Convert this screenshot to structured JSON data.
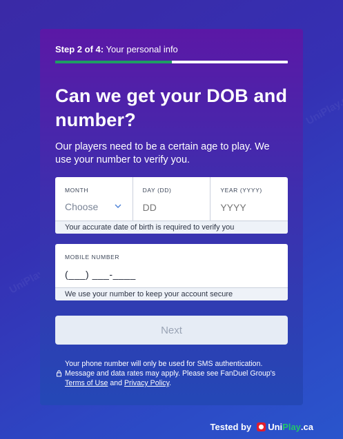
{
  "watermark": "UniPlay.ca",
  "step": {
    "prefix": "Step 2 of 4:",
    "label": "Your personal info",
    "progress": 0.5,
    "progress_color": "#1f9e63"
  },
  "heading": "Can we get your DOB and number?",
  "subtitle": "Our players need to be a certain age to play. We use your number to verify you.",
  "dob": {
    "month": {
      "label": "MONTH",
      "value": "Choose",
      "icon": "chevron-down-icon"
    },
    "day": {
      "label": "DAY (DD)",
      "placeholder": "DD"
    },
    "year": {
      "label": "YEAR (YYYY)",
      "placeholder": "YYYY"
    },
    "helper": "Your accurate date of birth is required to verify you"
  },
  "phone": {
    "label": "MOBILE NUMBER",
    "placeholder": "(___) ___-____",
    "helper": "We use your number to keep your account secure"
  },
  "next_label": "Next",
  "disclaimer": {
    "icon": "lock-icon",
    "text_before": "Your phone number will only be used for SMS authentication. Message and data rates may apply. Please see FanDuel Group's ",
    "terms": "Terms of Use",
    "and": " and ",
    "privacy": "Privacy Policy",
    "end": "."
  },
  "footer": {
    "tested_by": "Tested by",
    "brand_uni": "Uni",
    "brand_play": "Play",
    "brand_ca": ".ca"
  }
}
